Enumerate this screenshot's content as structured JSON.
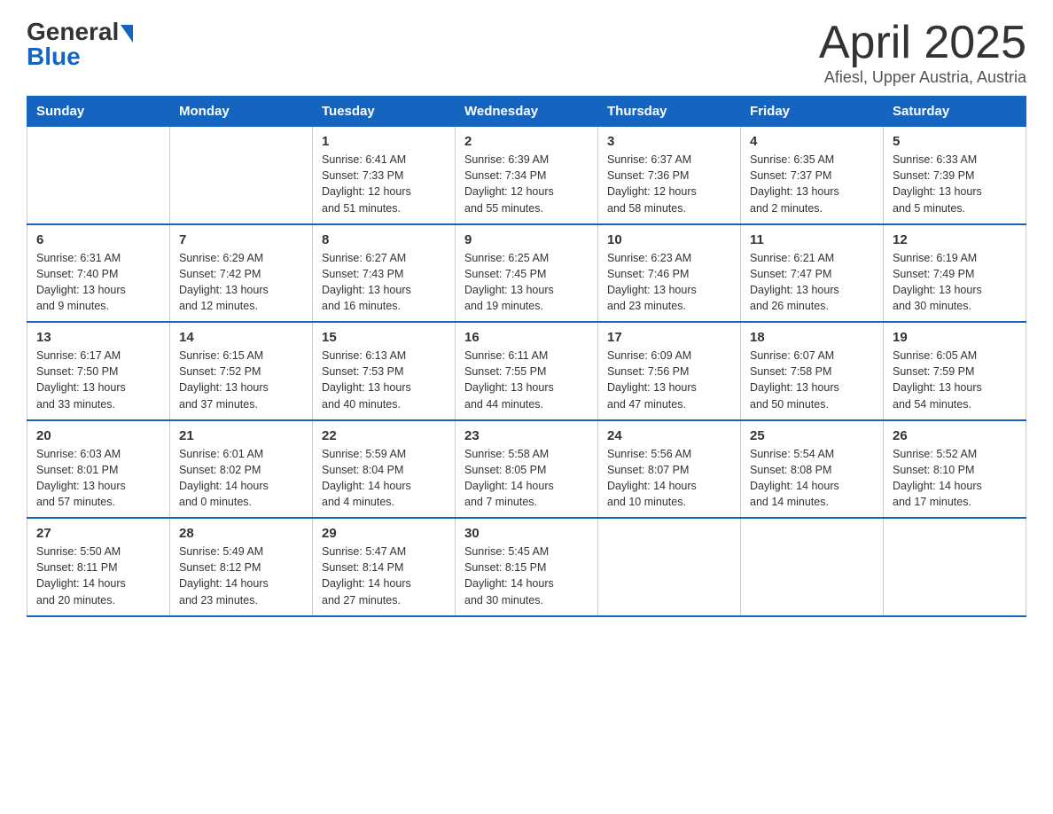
{
  "header": {
    "logo_general": "General",
    "logo_blue": "Blue",
    "title": "April 2025",
    "subtitle": "Afiesl, Upper Austria, Austria"
  },
  "calendar": {
    "days_of_week": [
      "Sunday",
      "Monday",
      "Tuesday",
      "Wednesday",
      "Thursday",
      "Friday",
      "Saturday"
    ],
    "weeks": [
      [
        {
          "day": "",
          "info": ""
        },
        {
          "day": "",
          "info": ""
        },
        {
          "day": "1",
          "info": "Sunrise: 6:41 AM\nSunset: 7:33 PM\nDaylight: 12 hours\nand 51 minutes."
        },
        {
          "day": "2",
          "info": "Sunrise: 6:39 AM\nSunset: 7:34 PM\nDaylight: 12 hours\nand 55 minutes."
        },
        {
          "day": "3",
          "info": "Sunrise: 6:37 AM\nSunset: 7:36 PM\nDaylight: 12 hours\nand 58 minutes."
        },
        {
          "day": "4",
          "info": "Sunrise: 6:35 AM\nSunset: 7:37 PM\nDaylight: 13 hours\nand 2 minutes."
        },
        {
          "day": "5",
          "info": "Sunrise: 6:33 AM\nSunset: 7:39 PM\nDaylight: 13 hours\nand 5 minutes."
        }
      ],
      [
        {
          "day": "6",
          "info": "Sunrise: 6:31 AM\nSunset: 7:40 PM\nDaylight: 13 hours\nand 9 minutes."
        },
        {
          "day": "7",
          "info": "Sunrise: 6:29 AM\nSunset: 7:42 PM\nDaylight: 13 hours\nand 12 minutes."
        },
        {
          "day": "8",
          "info": "Sunrise: 6:27 AM\nSunset: 7:43 PM\nDaylight: 13 hours\nand 16 minutes."
        },
        {
          "day": "9",
          "info": "Sunrise: 6:25 AM\nSunset: 7:45 PM\nDaylight: 13 hours\nand 19 minutes."
        },
        {
          "day": "10",
          "info": "Sunrise: 6:23 AM\nSunset: 7:46 PM\nDaylight: 13 hours\nand 23 minutes."
        },
        {
          "day": "11",
          "info": "Sunrise: 6:21 AM\nSunset: 7:47 PM\nDaylight: 13 hours\nand 26 minutes."
        },
        {
          "day": "12",
          "info": "Sunrise: 6:19 AM\nSunset: 7:49 PM\nDaylight: 13 hours\nand 30 minutes."
        }
      ],
      [
        {
          "day": "13",
          "info": "Sunrise: 6:17 AM\nSunset: 7:50 PM\nDaylight: 13 hours\nand 33 minutes."
        },
        {
          "day": "14",
          "info": "Sunrise: 6:15 AM\nSunset: 7:52 PM\nDaylight: 13 hours\nand 37 minutes."
        },
        {
          "day": "15",
          "info": "Sunrise: 6:13 AM\nSunset: 7:53 PM\nDaylight: 13 hours\nand 40 minutes."
        },
        {
          "day": "16",
          "info": "Sunrise: 6:11 AM\nSunset: 7:55 PM\nDaylight: 13 hours\nand 44 minutes."
        },
        {
          "day": "17",
          "info": "Sunrise: 6:09 AM\nSunset: 7:56 PM\nDaylight: 13 hours\nand 47 minutes."
        },
        {
          "day": "18",
          "info": "Sunrise: 6:07 AM\nSunset: 7:58 PM\nDaylight: 13 hours\nand 50 minutes."
        },
        {
          "day": "19",
          "info": "Sunrise: 6:05 AM\nSunset: 7:59 PM\nDaylight: 13 hours\nand 54 minutes."
        }
      ],
      [
        {
          "day": "20",
          "info": "Sunrise: 6:03 AM\nSunset: 8:01 PM\nDaylight: 13 hours\nand 57 minutes."
        },
        {
          "day": "21",
          "info": "Sunrise: 6:01 AM\nSunset: 8:02 PM\nDaylight: 14 hours\nand 0 minutes."
        },
        {
          "day": "22",
          "info": "Sunrise: 5:59 AM\nSunset: 8:04 PM\nDaylight: 14 hours\nand 4 minutes."
        },
        {
          "day": "23",
          "info": "Sunrise: 5:58 AM\nSunset: 8:05 PM\nDaylight: 14 hours\nand 7 minutes."
        },
        {
          "day": "24",
          "info": "Sunrise: 5:56 AM\nSunset: 8:07 PM\nDaylight: 14 hours\nand 10 minutes."
        },
        {
          "day": "25",
          "info": "Sunrise: 5:54 AM\nSunset: 8:08 PM\nDaylight: 14 hours\nand 14 minutes."
        },
        {
          "day": "26",
          "info": "Sunrise: 5:52 AM\nSunset: 8:10 PM\nDaylight: 14 hours\nand 17 minutes."
        }
      ],
      [
        {
          "day": "27",
          "info": "Sunrise: 5:50 AM\nSunset: 8:11 PM\nDaylight: 14 hours\nand 20 minutes."
        },
        {
          "day": "28",
          "info": "Sunrise: 5:49 AM\nSunset: 8:12 PM\nDaylight: 14 hours\nand 23 minutes."
        },
        {
          "day": "29",
          "info": "Sunrise: 5:47 AM\nSunset: 8:14 PM\nDaylight: 14 hours\nand 27 minutes."
        },
        {
          "day": "30",
          "info": "Sunrise: 5:45 AM\nSunset: 8:15 PM\nDaylight: 14 hours\nand 30 minutes."
        },
        {
          "day": "",
          "info": ""
        },
        {
          "day": "",
          "info": ""
        },
        {
          "day": "",
          "info": ""
        }
      ]
    ]
  }
}
